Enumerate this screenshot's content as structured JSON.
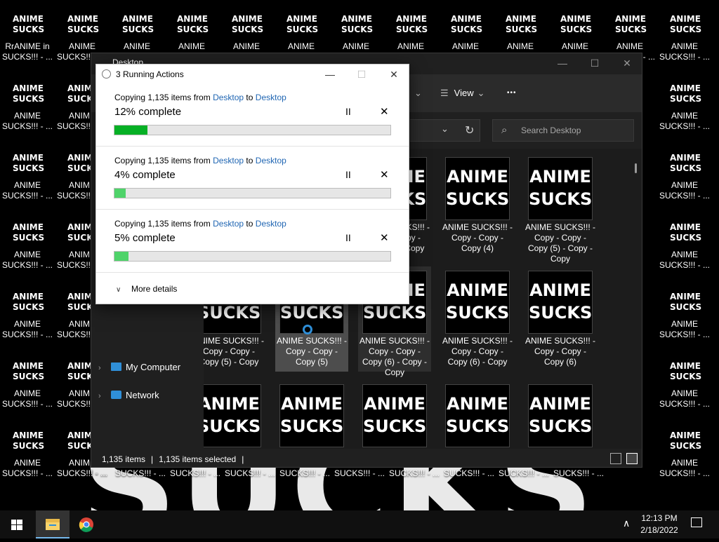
{
  "desktop": {
    "background_text": "SUCKS",
    "icon_thumb_text": "ANIME SUCKS",
    "row_labels": [
      "ANIME\nSUCKS!!! - ...",
      "ANIME\nSUCKS!!! - ...",
      "ANIME\nSUCKS!!! - ...",
      "ANIME\nSUCKS!!! - ...",
      "ANIME\nSUCKS!!! - ...",
      "ANIME\nSUCKS!!! - ...",
      "ANIME\nSUCKS!!! - ..."
    ],
    "first_label": "RrANIME in\nSUCKS!!! - ...",
    "bottom_row_label": "SUCKS!!! - ..."
  },
  "explorer": {
    "title": "Desktop",
    "view_label": "View",
    "more_label": "•••",
    "search_placeholder": "Search Desktop",
    "nav": [
      {
        "label": "My Computer",
        "icon": "monitor-icon"
      },
      {
        "label": "Network",
        "icon": "network-icon"
      }
    ],
    "tiles_row1": [
      {
        "caption": "ANIME SUCKS!!! -\nCopy - Copy -\nCopy (4) - Copy"
      },
      {
        "caption": "ANIME SUCKS!!! -\nCopy - Copy -\nCopy (4)"
      },
      {
        "caption": "ANIME SUCKS!!! -\nCopy - Copy -\nCopy (5) - Copy -\nCopy"
      }
    ],
    "tiles_row2": [
      {
        "caption": "ANIME SUCKS!!! -\nCopy - Copy -\nCopy (5) - Copy"
      },
      {
        "caption": "ANIME SUCKS!!! -\nCopy - Copy -\nCopy (5)"
      },
      {
        "caption": "ANIME SUCKS!!! -\nCopy - Copy -\nCopy (6) - Copy -\nCopy"
      },
      {
        "caption": "ANIME SUCKS!!! -\nCopy - Copy -\nCopy (6) - Copy"
      },
      {
        "caption": "ANIME SUCKS!!! -\nCopy - Copy -\nCopy (6)"
      }
    ],
    "tile_image_text": "ANIME\nSUCKS",
    "status": {
      "items": "1,135 items",
      "selected": "1,135 items selected"
    }
  },
  "dialog": {
    "title": "3 Running Actions",
    "operations": [
      {
        "prefix": "Copying 1,135 items from ",
        "from": "Desktop",
        "mid": " to ",
        "to": "Desktop",
        "percent_text": "12% complete",
        "progress": 0.12,
        "color": "#06b025"
      },
      {
        "prefix": "Copying 1,135 items from ",
        "from": "Desktop",
        "mid": " to ",
        "to": "Desktop",
        "percent_text": "4% complete",
        "progress": 0.04,
        "color": "#4fd36a"
      },
      {
        "prefix": "Copying 1,135 items from ",
        "from": "Desktop",
        "mid": " to ",
        "to": "Desktop",
        "percent_text": "5% complete",
        "progress": 0.05,
        "color": "#4fd36a"
      }
    ],
    "more_details": "More details",
    "pause_glyph": "II",
    "cancel_glyph": "✕"
  },
  "taskbar": {
    "time": "12:13 PM",
    "date": "2/18/2022",
    "apps": [
      "windows-start-icon",
      "file-explorer-icon",
      "chrome-icon"
    ]
  },
  "colors": {
    "accent": "#2066b3",
    "progress_green": "#06b025"
  }
}
